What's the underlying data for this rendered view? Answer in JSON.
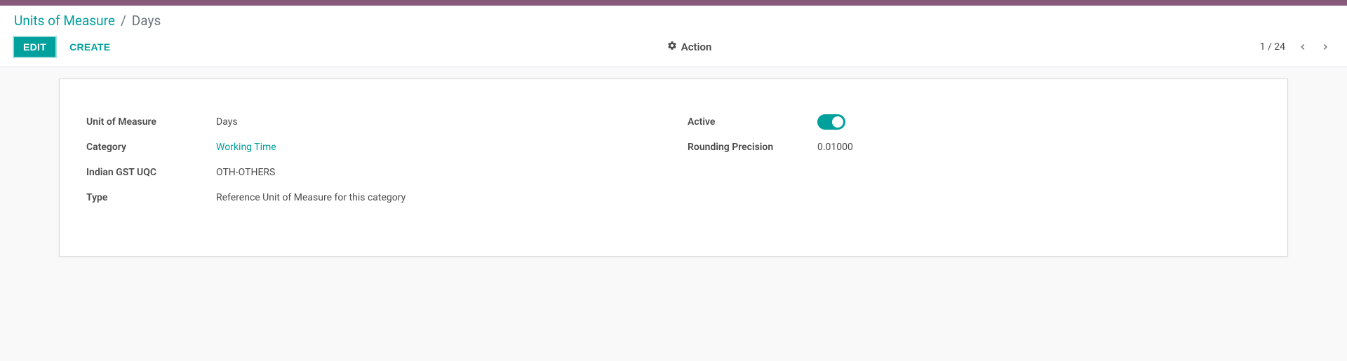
{
  "breadcrumb": {
    "parent": "Units of Measure",
    "separator": "/",
    "current": "Days"
  },
  "toolbar": {
    "edit_label": "EDIT",
    "create_label": "CREATE",
    "action_label": "Action"
  },
  "pager": {
    "text": "1 / 24"
  },
  "form": {
    "left": {
      "unit_of_measure": {
        "label": "Unit of Measure",
        "value": "Days"
      },
      "category": {
        "label": "Category",
        "value": "Working Time"
      },
      "indian_gst_uqc": {
        "label": "Indian GST UQC",
        "value": "OTH-OTHERS"
      },
      "type": {
        "label": "Type",
        "value": "Reference Unit of Measure for this category"
      }
    },
    "right": {
      "active": {
        "label": "Active",
        "value": true
      },
      "rounding_precision": {
        "label": "Rounding Precision",
        "value": "0.01000"
      }
    }
  }
}
